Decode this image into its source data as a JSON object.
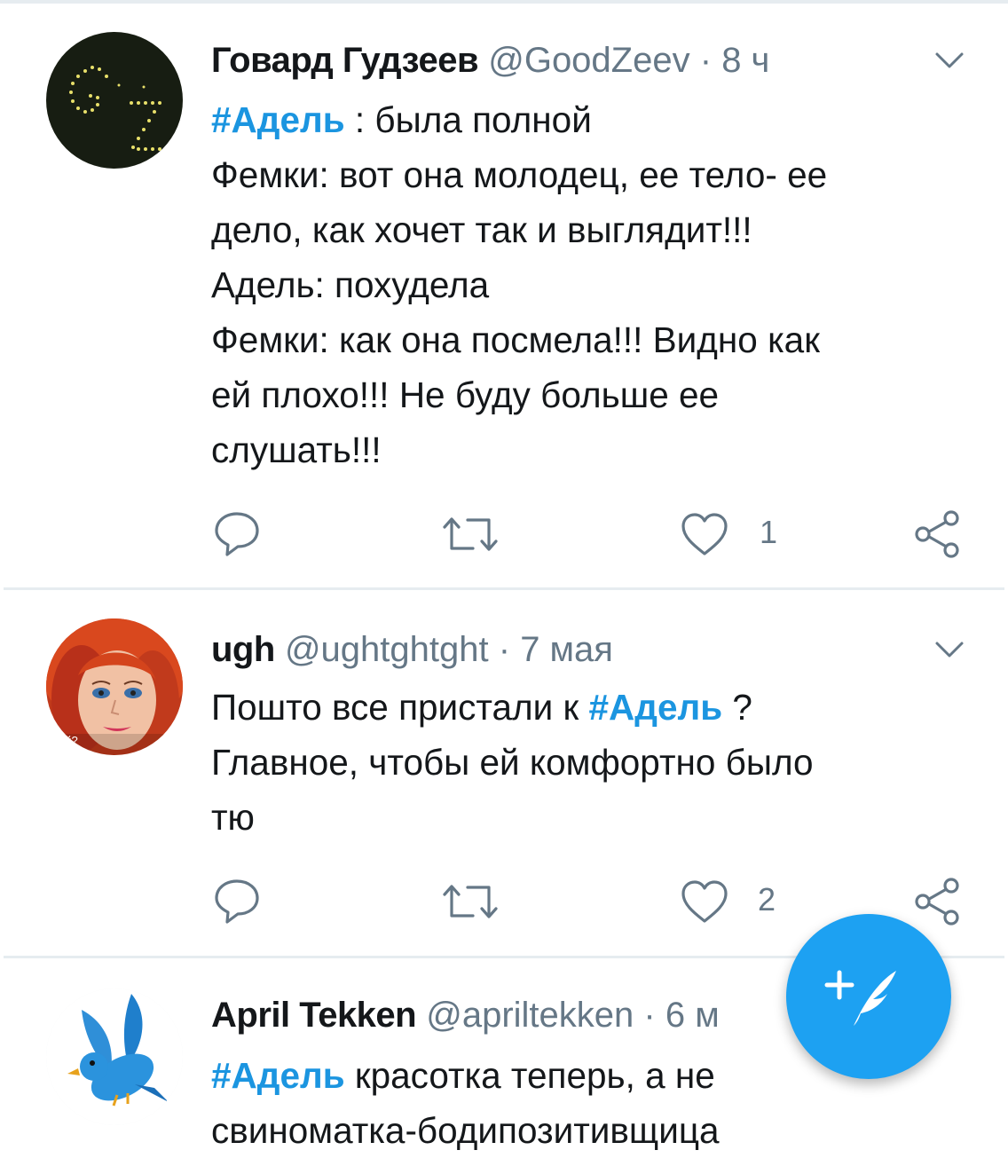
{
  "tweets": [
    {
      "name": "Говард Гудзеев",
      "handle": "@GoodZeev",
      "separator": "·",
      "time": "8 ч",
      "hashtag": "#Адель",
      "text_after_tag": " : была полной\nФемки: вот она молодец, ее тело- ее\nдело, как хочет так и выглядит!!!\nАдель: похудела\nФемки: как она посмела!!! Видно как\nей плохо!!! Не буду больше ее\nслушать!!!",
      "likes": "1"
    },
    {
      "name": "ugh",
      "handle": "@ughtghtght",
      "separator": "·",
      "time": "7 мая",
      "text_before_tag": "Пошто все пристали к ",
      "hashtag": "#Адель",
      "text_after_tag": " ?\nГлавное, чтобы ей комфортно было\nтю",
      "avatar_caption": "ей?",
      "likes": "2"
    },
    {
      "name": "April Tekken",
      "handle": "@apriltekken",
      "separator": "·",
      "time": "6 м",
      "hashtag": "#Адель",
      "text_after_tag": " красотка теперь, а не\nсвиноматка-бодипозитивщица"
    }
  ],
  "icons": {
    "reply": "reply-icon",
    "retweet": "retweet-icon",
    "like": "heart-icon",
    "share": "share-icon",
    "menu": "chevron-down-icon",
    "compose": "compose-tweet-icon"
  },
  "colors": {
    "accent": "#1da1f2",
    "hashtag": "#1b95e0",
    "secondary_text": "#657786",
    "divider": "#e6ecf0"
  }
}
